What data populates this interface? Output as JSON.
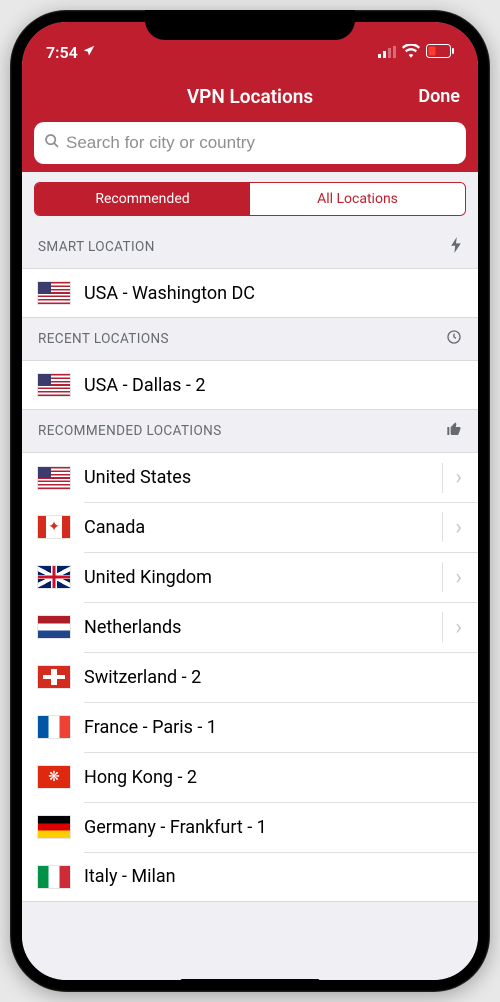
{
  "status": {
    "time": "7:54",
    "location_icon": "location-arrow",
    "signal_icon": "signal",
    "wifi_icon": "wifi",
    "battery_icon": "battery-low"
  },
  "nav": {
    "title": "VPN Locations",
    "done": "Done"
  },
  "search": {
    "placeholder": "Search for city or country"
  },
  "segmented": {
    "recommended": "Recommended",
    "all": "All Locations",
    "active": "recommended"
  },
  "sections": {
    "smart": {
      "title": "SMART LOCATION",
      "icon": "lightning",
      "items": [
        {
          "flag": "us",
          "label": "USA - Washington DC"
        }
      ]
    },
    "recent": {
      "title": "RECENT LOCATIONS",
      "icon": "clock",
      "items": [
        {
          "flag": "us",
          "label": "USA - Dallas - 2"
        }
      ]
    },
    "recommended": {
      "title": "RECOMMENDED LOCATIONS",
      "icon": "thumbs-up",
      "items": [
        {
          "flag": "us",
          "label": "United States",
          "disclosure": true
        },
        {
          "flag": "ca",
          "label": "Canada",
          "disclosure": true
        },
        {
          "flag": "gb",
          "label": "United Kingdom",
          "disclosure": true
        },
        {
          "flag": "nl",
          "label": "Netherlands",
          "disclosure": true
        },
        {
          "flag": "ch",
          "label": "Switzerland - 2",
          "disclosure": false
        },
        {
          "flag": "fr",
          "label": "France - Paris - 1",
          "disclosure": false
        },
        {
          "flag": "hk",
          "label": "Hong Kong - 2",
          "disclosure": false
        },
        {
          "flag": "de",
          "label": "Germany - Frankfurt - 1",
          "disclosure": false
        },
        {
          "flag": "it",
          "label": "Italy - Milan",
          "disclosure": false
        }
      ]
    }
  },
  "colors": {
    "brand": "#bf1e2e"
  }
}
